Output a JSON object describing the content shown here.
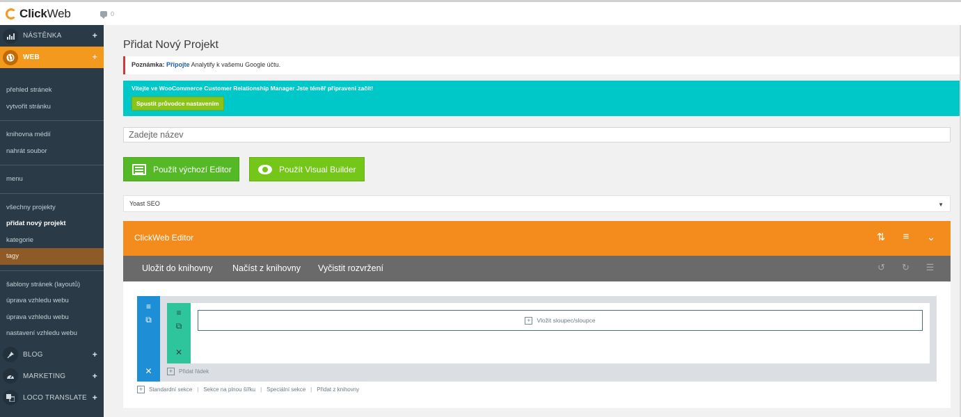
{
  "app": {
    "logo_bold": "Click",
    "logo_rest": "Web",
    "comments_count": "0"
  },
  "sidebar": {
    "dashboard": "NÁSTĚNKA",
    "web": "WEB",
    "web_items": [
      "přehled stránek",
      "vytvořit stránku"
    ],
    "media_items": [
      "knihovna médií",
      "nahrát soubor"
    ],
    "menu_item": "menu",
    "project_items": [
      "všechny projekty",
      "přidat nový projekt",
      "kategorie",
      "tagy"
    ],
    "layout_items": [
      "šablony stránek (layoutů)",
      "úprava vzhledu webu",
      "úprava vzhledu webu",
      "nastavení vzhledu webu"
    ],
    "blog": "BLOG",
    "marketing": "MARKETING",
    "loco": "LOCO TRANSLATE",
    "plus": "+"
  },
  "main": {
    "page_title": "Přidat Nový Projekt",
    "notice_label": "Poznámka:",
    "notice_link": "Připojte",
    "notice_rest": "Analytify k vašemu Google účtu.",
    "woo_text": "Vítejte ve WooCommerce Customer Relationship Manager Jste téměř připraveni začít!",
    "woo_button": "Spustit průvodce nastavením",
    "title_placeholder": "Zadejte název",
    "btn_default_editor": "Použít výchozí Editor",
    "btn_visual_builder": "Použít Visual Builder",
    "yoast_label": "Yoast SEO"
  },
  "editor": {
    "title": "ClickWeb Editor",
    "toolbar": [
      "Uložit do knihovny",
      "Načíst z knihovny",
      "Vyčistit rozvržení"
    ],
    "insert_column": "Vložit sloupec/sloupce",
    "add_row": "Přidat řádek",
    "section_links": [
      "Standardní sekce",
      "Sekce na plnou šířku",
      "Speciální sekce",
      "Přidat z knihovny"
    ]
  },
  "colors": {
    "accent_orange": "#f38c1c",
    "sidebar_bg": "#2a3b47",
    "woo_bg": "#00c8c8",
    "button_green": "#55b927",
    "section_blue": "#1e8fd7",
    "row_teal": "#2ec49c"
  },
  "icons": [
    "chart-icon",
    "globe-icon",
    "pin-icon",
    "gauge-icon",
    "translate-icon",
    "comment-icon",
    "sort-icon",
    "menu-icon",
    "chevron-down-icon",
    "undo-icon",
    "redo-icon",
    "history-icon",
    "close-icon",
    "duplicate-icon",
    "eye-icon",
    "editor-icon"
  ]
}
